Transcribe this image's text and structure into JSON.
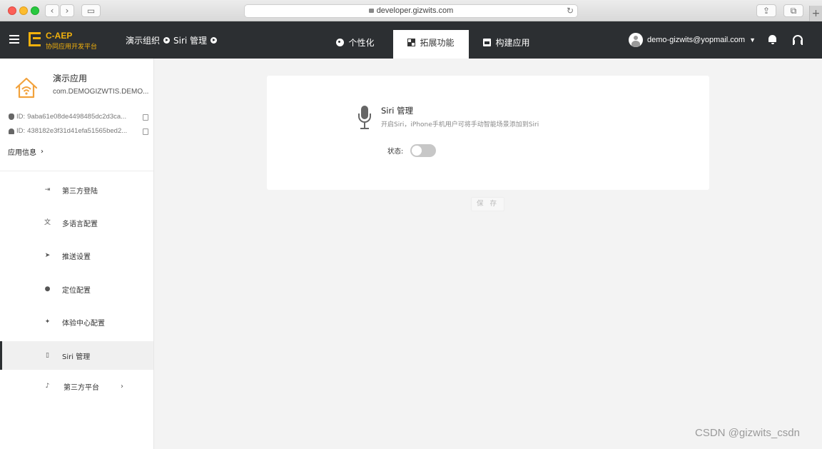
{
  "browser": {
    "url": "developer.gizwits.com",
    "reload_icon": "reload-icon"
  },
  "header": {
    "brand_name": "C-AEP",
    "brand_subtitle": "协同应用开发平台",
    "breadcrumb": [
      "演示组织",
      "Siri 管理"
    ],
    "tabs": [
      {
        "label": "个性化",
        "icon": "palette-icon",
        "active": false
      },
      {
        "label": "拓展功能",
        "icon": "extension-icon",
        "active": true
      },
      {
        "label": "构建应用",
        "icon": "build-icon",
        "active": false
      }
    ],
    "user_email": "demo-gizwits@yopmail.com",
    "colors": {
      "bar": "#2c2f32",
      "brand": "#f2b10c"
    }
  },
  "app": {
    "name": "演示应用",
    "package": "com.DEMOGIZWTIS.DEMO...",
    "ios_id_label": "ID:",
    "ios_id": "9aba61e08de4498485dc2d3ca...",
    "android_id_label": "ID:",
    "android_id": "438182e3f31d41efa51565bed2...",
    "info_link": "应用信息"
  },
  "nav": [
    {
      "label": "第三方登陆",
      "icon": "login-icon",
      "glyph": "⇥",
      "active": false
    },
    {
      "label": "多语言配置",
      "icon": "translate-icon",
      "glyph": "文",
      "active": false
    },
    {
      "label": "推送设置",
      "icon": "send-icon",
      "glyph": "➤",
      "active": false
    },
    {
      "label": "定位配置",
      "icon": "location-pin-icon",
      "glyph": "●",
      "active": false
    },
    {
      "label": "体验中心配置",
      "icon": "magic-wand-icon",
      "glyph": "✦",
      "active": false
    },
    {
      "label": "Siri 管理",
      "icon": "phone-icon",
      "glyph": "▯",
      "active": true
    },
    {
      "label": "第三方平台",
      "icon": "mic-icon",
      "glyph": "♪",
      "active": false,
      "has_chevron": true
    }
  ],
  "main": {
    "title": "Siri 管理",
    "description": "开启Siri，iPhone手机用户可将手动智能场景添加到Siri",
    "status_label": "状态:",
    "status_enabled": false,
    "save_label": "保 存"
  },
  "watermark": "CSDN @gizwits_csdn"
}
